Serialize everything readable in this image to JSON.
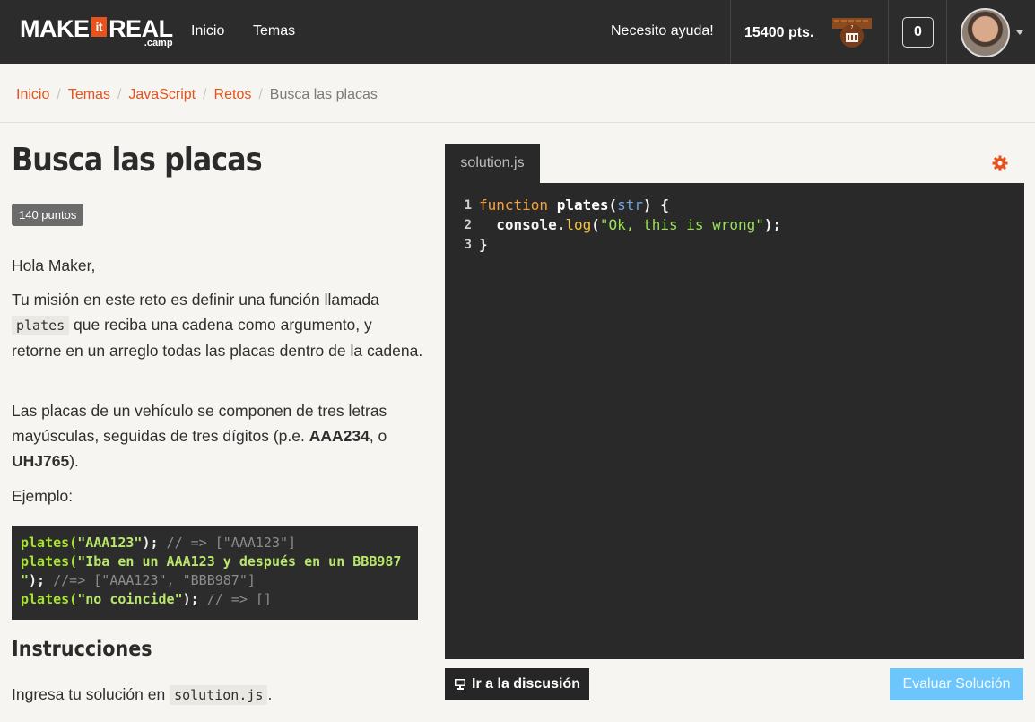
{
  "header": {
    "logo_make": "MAKE",
    "logo_it": "it",
    "logo_real": "REAL",
    "logo_camp": ".camp",
    "nav": [
      "Inicio",
      "Temas"
    ],
    "help_label": "Necesito ayuda!",
    "points_label": "15400 pts.",
    "notifications_count": "0",
    "icons": [
      "level-badge-icon",
      "avatar",
      "caret-down-icon"
    ]
  },
  "breadcrumb": {
    "items": [
      "Inicio",
      "Temas",
      "JavaScript",
      "Retos"
    ],
    "separator": "/",
    "current": "Busca las placas"
  },
  "challenge": {
    "title": "Busca las placas",
    "points_badge": "140 puntos",
    "greeting": "Hola Maker,",
    "p1_before": "Tu misión en este reto es definir una función llamada ",
    "p1_code": "plates",
    "p1_after": " que reciba una cadena como argumento, y retorne en un arreglo todas las placas dentro de la cadena.",
    "p2_before": "Las placas de un vehículo se componen de tres letras mayúsculas, seguidas de tres dígitos (p.e. ",
    "p2_bold1": "AAA234",
    "p2_mid": ", o ",
    "p2_bold2": "UHJ765",
    "p2_after": ").",
    "example_label": "Ejemplo:",
    "example": {
      "l1_fn": "plates(",
      "l1_str": "\"AAA123\"",
      "l1_end": ");",
      "l1_com": " // => [\"AAA123\"]",
      "l2_fn": "plates(",
      "l2_str": "\"Iba en un AAA123 y después en un BBB987",
      "l3_str": "\"",
      "l3_end": ");",
      "l3_com": " //=> [\"AAA123\", \"BBB987\"]",
      "l4_fn": "plates(",
      "l4_str": "\"no coincide\"",
      "l4_end": ");",
      "l4_com": " // => []"
    },
    "instructions_title": "Instrucciones",
    "instructions_before": "Ingresa tu solución en ",
    "instructions_code": "solution.js",
    "instructions_after": "."
  },
  "editor": {
    "tab": "solution.js",
    "settings_icon": "gear-icon",
    "lines": [
      {
        "n": "1",
        "kw": "function",
        "fn": " plates",
        "p1": "(",
        "param": "str",
        "p2": ") {"
      },
      {
        "n": "2",
        "obj": "  console",
        "dot": ".",
        "meth": "log",
        "open": "(",
        "str": "\"Ok, this is wrong\"",
        "close": ");"
      },
      {
        "n": "3",
        "pl": "}"
      }
    ]
  },
  "actions": {
    "discuss_label": "Ir a la discusión",
    "discuss_icon": "presentation-icon",
    "evaluate_label": "Evaluar Solución"
  },
  "colors": {
    "accent": "#e2531e",
    "header_bg": "#2c2c2c",
    "editor_bg": "#292929",
    "evaluate_btn": "#6cc6fb"
  }
}
